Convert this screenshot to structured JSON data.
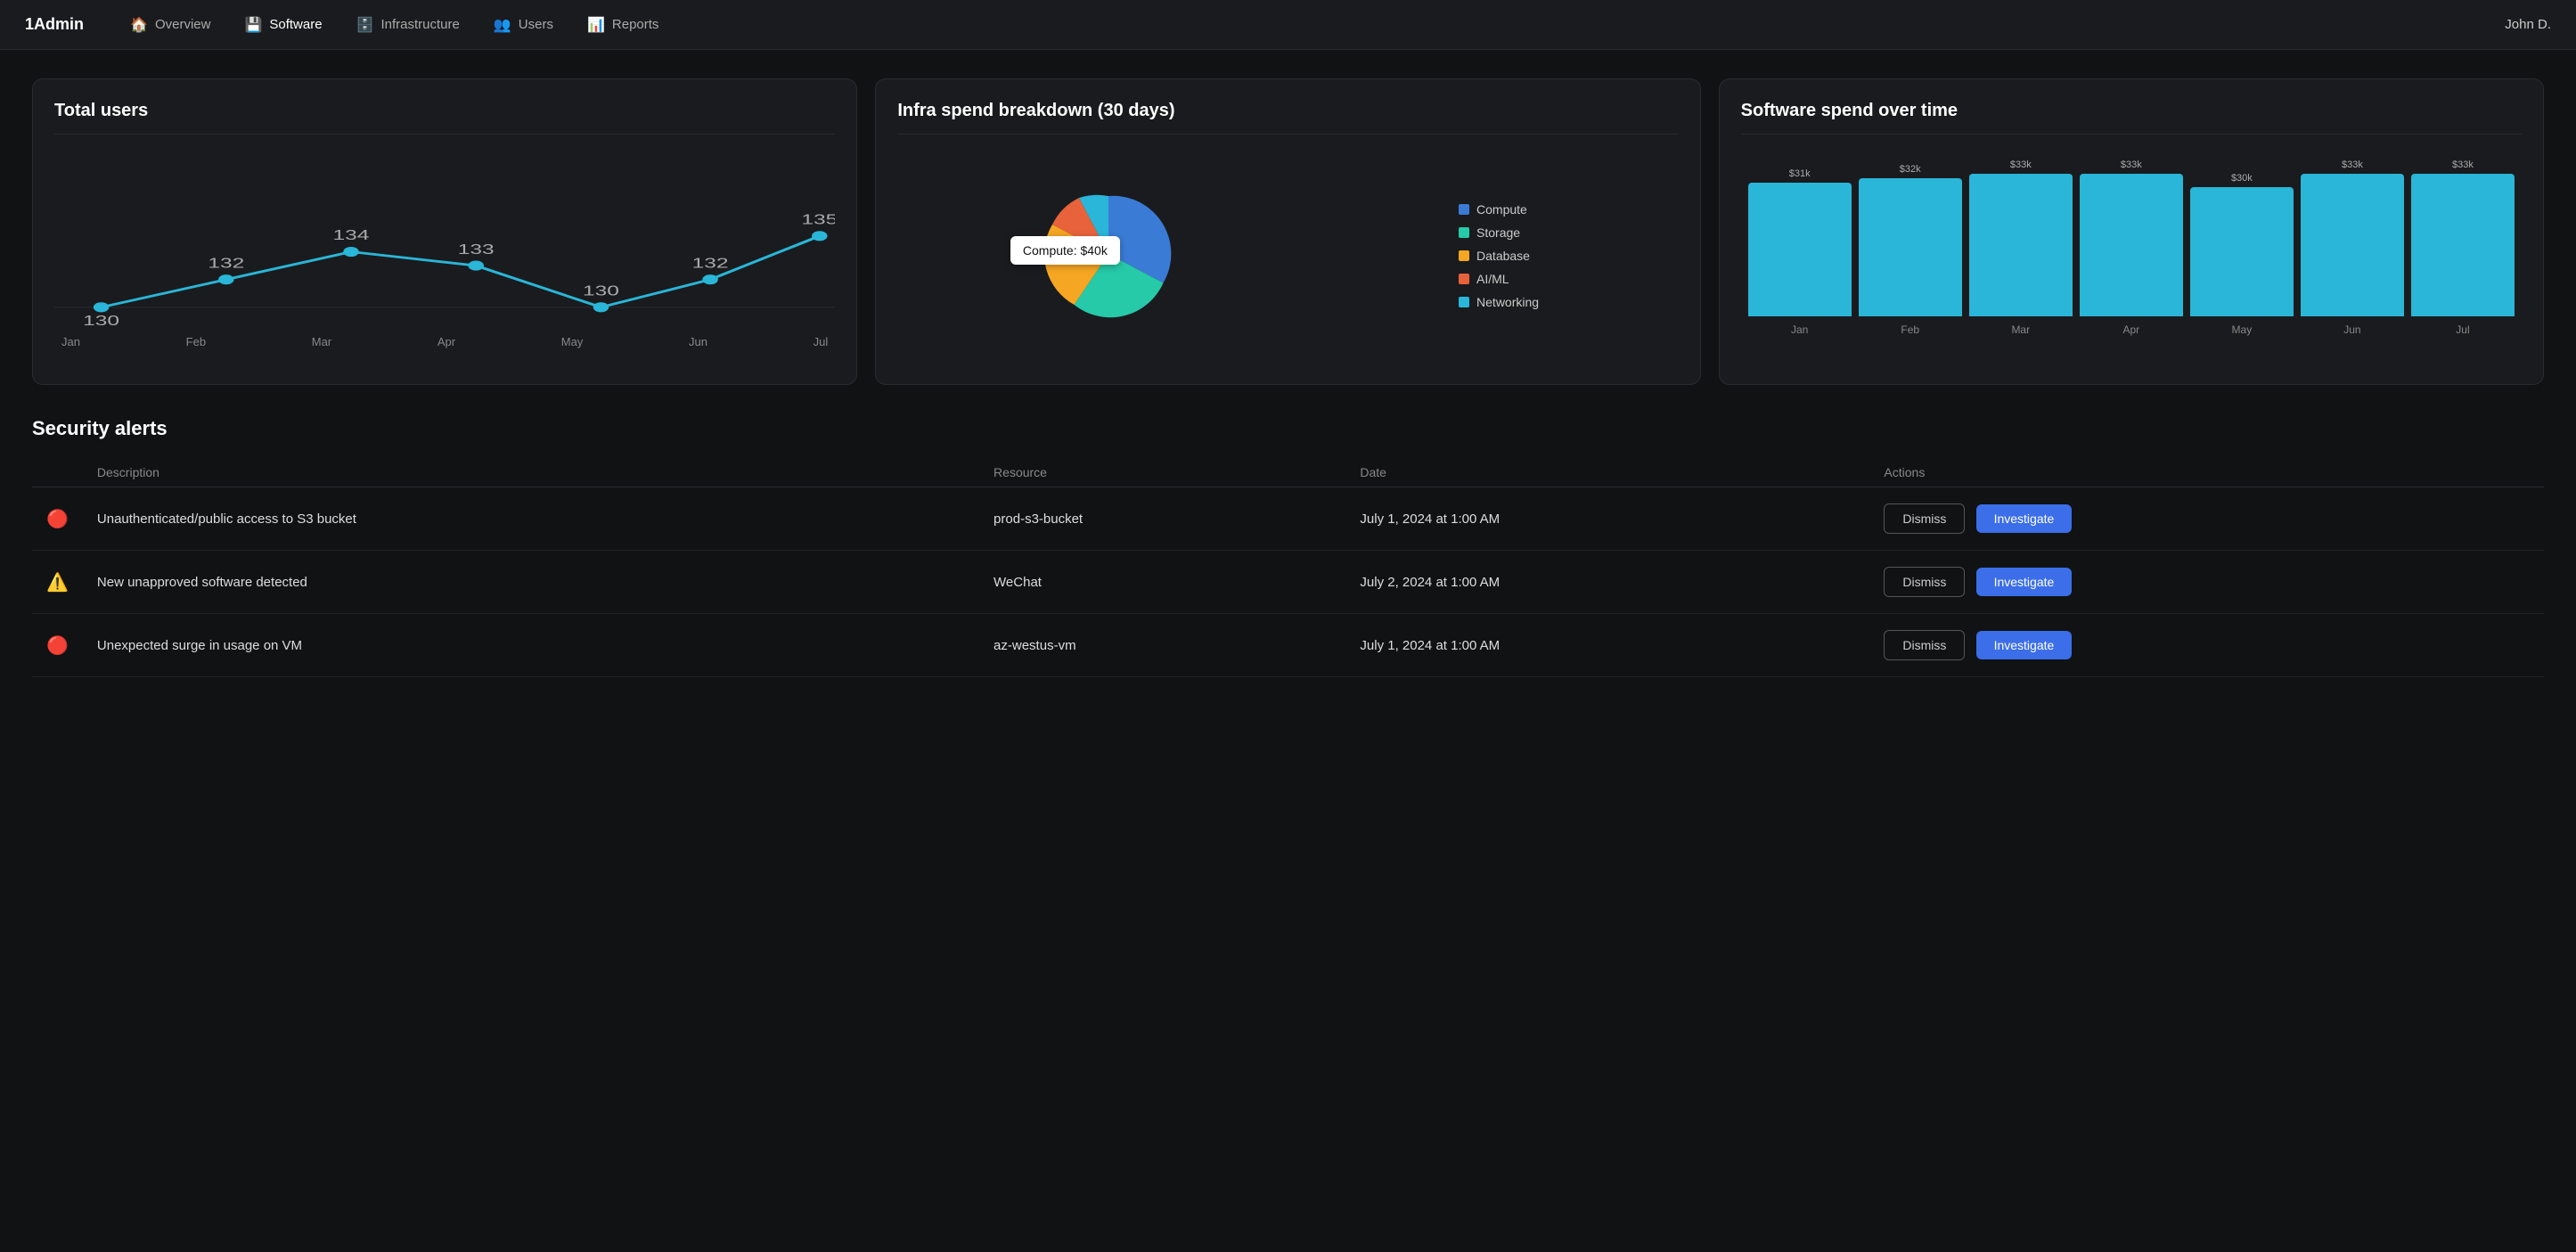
{
  "brand": "1Admin",
  "nav": {
    "items": [
      {
        "id": "overview",
        "label": "Overview",
        "icon": "🏠"
      },
      {
        "id": "software",
        "label": "Software",
        "icon": "💾"
      },
      {
        "id": "infrastructure",
        "label": "Infrastructure",
        "icon": "🗄️"
      },
      {
        "id": "users",
        "label": "Users",
        "icon": "👥"
      },
      {
        "id": "reports",
        "label": "Reports",
        "icon": "📊"
      }
    ],
    "user": "John D."
  },
  "cards": {
    "total_users": {
      "title": "Total users",
      "months": [
        "Jan",
        "Feb",
        "Mar",
        "Apr",
        "May",
        "Jun",
        "Jul"
      ],
      "values": [
        130,
        132,
        134,
        133,
        130,
        132,
        135
      ]
    },
    "infra_spend": {
      "title": "Infra spend breakdown (30 days)",
      "tooltip": "Compute: $40k",
      "legend": [
        {
          "label": "Compute",
          "color": "#3a7bd5"
        },
        {
          "label": "Storage",
          "color": "#26c9a8"
        },
        {
          "label": "Database",
          "color": "#f5a623"
        },
        {
          "label": "AI/ML",
          "color": "#e8623b"
        },
        {
          "label": "Networking",
          "color": "#29b6d8"
        }
      ]
    },
    "software_spend": {
      "title": "Software spend over time",
      "months": [
        "Jan",
        "Feb",
        "Mar",
        "Apr",
        "May",
        "Jun",
        "Jul"
      ],
      "values": [
        31,
        32,
        33,
        33,
        30,
        33,
        33
      ],
      "labels": [
        "$31k",
        "$32k",
        "$33k",
        "$33k",
        "$30k",
        "$33k",
        "$33k"
      ]
    }
  },
  "security_alerts": {
    "title": "Security alerts",
    "columns": [
      "Description",
      "Resource",
      "Date",
      "Actions"
    ],
    "rows": [
      {
        "icon_type": "red",
        "icon_symbol": "⊘",
        "description": "Unauthenticated/public access to S3 bucket",
        "resource": "prod-s3-bucket",
        "date": "July 1, 2024 at 1:00 AM",
        "dismiss_label": "Dismiss",
        "investigate_label": "Investigate"
      },
      {
        "icon_type": "orange",
        "icon_symbol": "⚠",
        "description": "New unapproved software detected",
        "resource": "WeChat",
        "date": "July 2, 2024 at 1:00 AM",
        "dismiss_label": "Dismiss",
        "investigate_label": "Investigate"
      },
      {
        "icon_type": "red",
        "icon_symbol": "⊘",
        "description": "Unexpected surge in usage on VM",
        "resource": "az-westus-vm",
        "date": "July 1, 2024 at 1:00 AM",
        "dismiss_label": "Dismiss",
        "investigate_label": "Investigate"
      }
    ]
  }
}
